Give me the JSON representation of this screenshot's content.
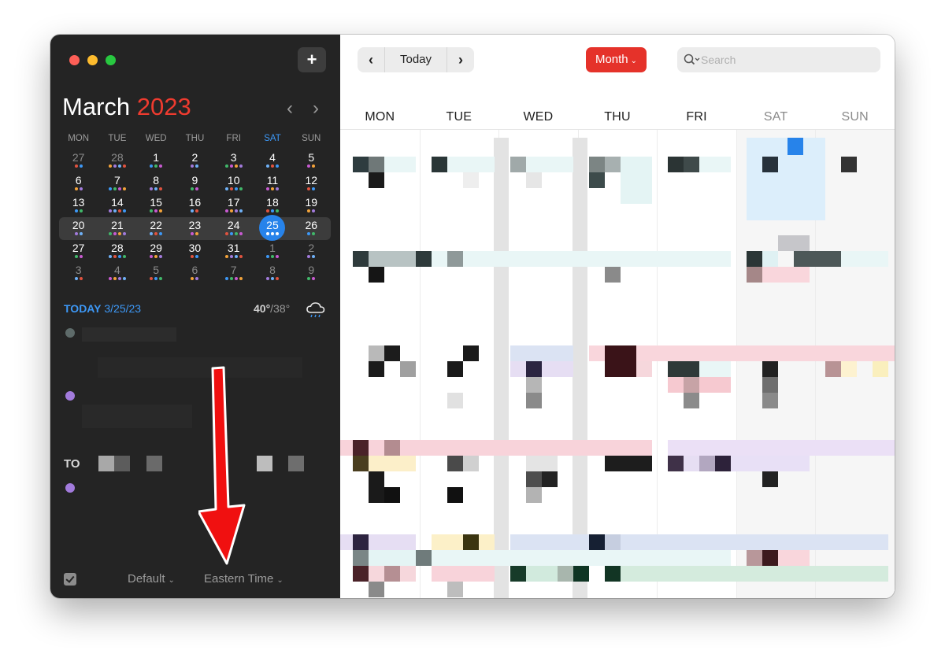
{
  "sidebar": {
    "add_label": "+",
    "month": "March",
    "year": "2023",
    "weekday_headers": [
      "MON",
      "TUE",
      "WED",
      "THU",
      "FRI",
      "SAT",
      "SUN"
    ],
    "weeks": [
      [
        "27",
        "28",
        "1",
        "2",
        "3",
        "4",
        "5"
      ],
      [
        "6",
        "7",
        "8",
        "9",
        "10",
        "11",
        "12"
      ],
      [
        "13",
        "14",
        "15",
        "16",
        "17",
        "18",
        "19"
      ],
      [
        "20",
        "21",
        "22",
        "23",
        "24",
        "25",
        "26"
      ],
      [
        "27",
        "28",
        "29",
        "30",
        "31",
        "1",
        "2"
      ],
      [
        "3",
        "4",
        "5",
        "6",
        "7",
        "8",
        "9"
      ]
    ],
    "selected_date": "25",
    "today_label": "TODAY",
    "today_date": "3/25/23",
    "temp_high": "40°",
    "temp_low": "/38°",
    "weather_icon": "rain-cloud-icon",
    "section_label": "TO",
    "calendar_set": "Default",
    "timezone": "Eastern Time"
  },
  "toolbar": {
    "prev": "‹",
    "today": "Today",
    "next": "›",
    "view": "Month",
    "search_placeholder": "Search"
  },
  "main": {
    "day_headers": [
      "MON",
      "TUE",
      "WED",
      "THU",
      "FRI",
      "SAT",
      "SUN"
    ]
  },
  "colors": {
    "accent_red": "#e5322a",
    "accent_blue": "#2783ea",
    "sidebar_bg": "#242424",
    "annotation_arrow": "#f01010"
  }
}
